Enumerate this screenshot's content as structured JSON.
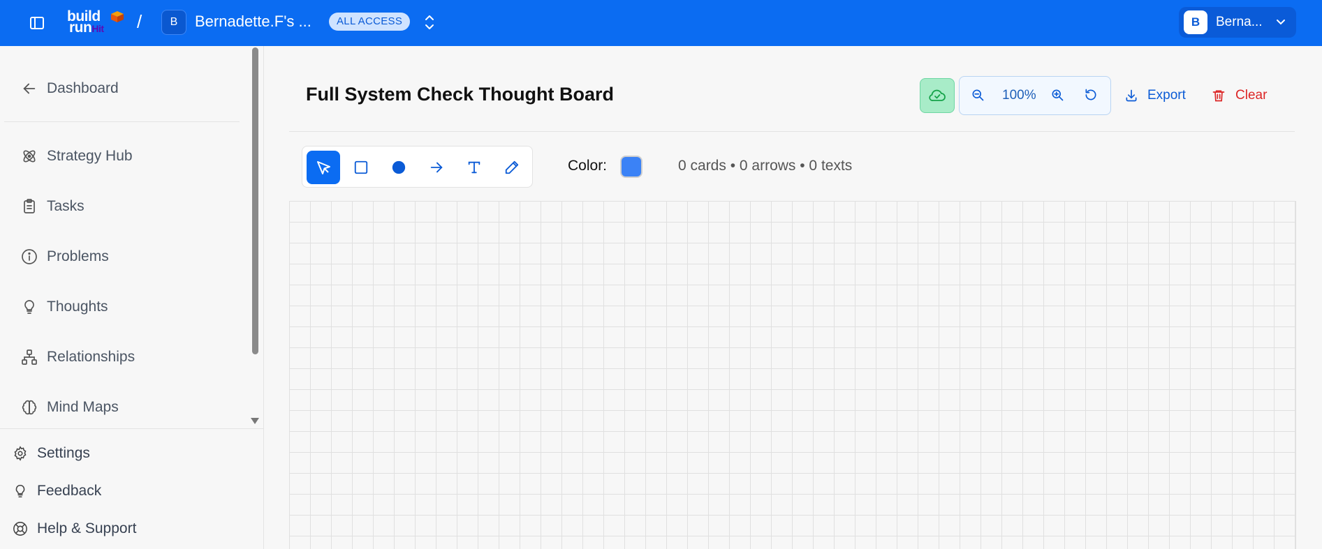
{
  "topbar": {
    "logo_line1": "build",
    "logo_line2": "run",
    "logo_hit": "Hit",
    "separator": "/",
    "workspace_initial": "B",
    "workspace_name": "Bernadette.F's ...",
    "access_badge": "ALL ACCESS",
    "user_initial": "B",
    "user_name": "Berna...",
    "brand_color": "#0b6cf2"
  },
  "sidebar": {
    "back_label": "Dashboard",
    "items": [
      {
        "label": "Strategy Hub",
        "icon": "atom-icon"
      },
      {
        "label": "Tasks",
        "icon": "clipboard-icon"
      },
      {
        "label": "Problems",
        "icon": "info-icon"
      },
      {
        "label": "Thoughts",
        "icon": "lightbulb-icon"
      },
      {
        "label": "Relationships",
        "icon": "network-icon"
      },
      {
        "label": "Mind Maps",
        "icon": "brain-icon"
      }
    ],
    "footer": [
      {
        "label": "Settings",
        "icon": "gear-icon"
      },
      {
        "label": "Feedback",
        "icon": "lightbulb-icon"
      },
      {
        "label": "Help & Support",
        "icon": "lifebuoy-icon"
      }
    ]
  },
  "main": {
    "title": "Full System Check Thought Board",
    "zoom_level": "100%",
    "export_label": "Export",
    "clear_label": "Clear",
    "tools": [
      "select",
      "rectangle",
      "circle",
      "arrow",
      "text",
      "pen"
    ],
    "active_tool": "select",
    "color_label": "Color:",
    "selected_color": "#3b82f6",
    "counts_text": "0 cards • 0 arrows • 0 texts"
  }
}
